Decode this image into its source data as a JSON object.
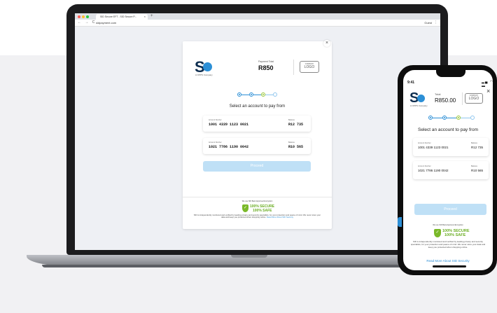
{
  "browser": {
    "tab_title": "SID Secure EFT - SID Secure P...",
    "tab_close": "×",
    "new_tab": "+",
    "nav_icons": "← → C",
    "url": "sidpayment.com",
    "profile": "Guest",
    "menu_icon": "⋮"
  },
  "brand": {
    "logo_letter": "S",
    "tagline": "A OPPS Company"
  },
  "payment": {
    "total_label_desktop": "Payment Total",
    "total_label_mobile": "Total",
    "amount_desktop": "R850",
    "amount_mobile": "R850.00",
    "company_logo_line1": "COMPANY",
    "company_logo_line2": "LOGO"
  },
  "steps": {
    "title": "Select an account to pay from"
  },
  "accounts": [
    {
      "number_label": "Account Number",
      "number": "1001 4339 1123 0021",
      "balance_label": "Balance",
      "balance": "R12 735"
    },
    {
      "number_label": "Account Number",
      "number": "1021 7786 1190 0042",
      "balance_label": "Balance",
      "balance": "R10 565"
    }
  ],
  "proceed_label": "Proceed",
  "footer": {
    "advisor": "We use SID Bank Approved Encryption",
    "secure": "100% SECURE",
    "safe": "100% SAFE",
    "shield_icon": "✓",
    "desc_desktop": "SID is independently monitored and verified by leading privacy and security specialists, for your protection and peace of mind. We never store your data and keep you protected when shopping online.",
    "link_desktop": "Read More About SID Security",
    "desc_mobile": "SID is independently monitored and verified by leading privacy and security specialists, for your protection and peace of mind. We never store your data and keep you protected when shopping online.",
    "link_mobile": "Read More About SID Security"
  },
  "phone": {
    "time": "9:41",
    "status_icons": "▂▄ ◠ ▬",
    "close": "×"
  },
  "colors": {
    "accent": "#2c8fd6",
    "green": "#7ab929",
    "button_disabled": "#bfe0f6"
  }
}
